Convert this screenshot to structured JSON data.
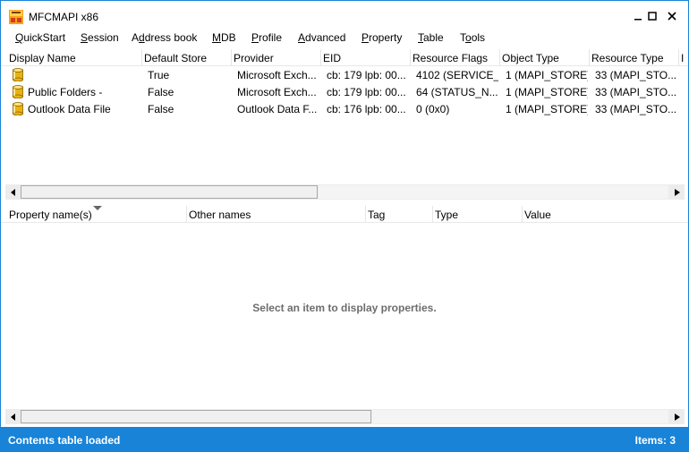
{
  "window": {
    "title": "MFCMAPI x86",
    "accent": "#1883d7"
  },
  "menu": [
    {
      "pre": "",
      "u": "Q",
      "post": "uickStart"
    },
    {
      "pre": "",
      "u": "S",
      "post": "ession"
    },
    {
      "pre": "A",
      "u": "d",
      "post": "dress book"
    },
    {
      "pre": "",
      "u": "M",
      "post": "DB"
    },
    {
      "pre": "",
      "u": "P",
      "post": "rofile"
    },
    {
      "pre": "",
      "u": "A",
      "post": "dvanced"
    },
    {
      "pre": "",
      "u": "P",
      "post": "roperty"
    },
    {
      "pre": "",
      "u": "T",
      "post": "able"
    },
    {
      "pre": "T",
      "u": "o",
      "post": "ols"
    }
  ],
  "stores_table": {
    "columns": [
      "Display Name",
      "Default Store",
      "Provider",
      "EID",
      "Resource Flags",
      "Object Type",
      "Resource Type",
      "I"
    ],
    "rows": [
      [
        "",
        "True",
        "Microsoft Exch...",
        "cb: 179 lpb: 00...",
        "4102 (SERVICE_...",
        "1 (MAPI_STORE)",
        "33 (MAPI_STO..."
      ],
      [
        "Public Folders -",
        "False",
        "Microsoft Exch...",
        "cb: 179 lpb: 00...",
        "64 (STATUS_N...",
        "1 (MAPI_STORE)",
        "33 (MAPI_STO..."
      ],
      [
        "Outlook Data File",
        "False",
        "Outlook Data F...",
        "cb: 176 lpb: 00...",
        "0 (0x0)",
        "1 (MAPI_STORE)",
        "33 (MAPI_STO..."
      ]
    ],
    "row_icon": "database-icon"
  },
  "props_table": {
    "columns": [
      "Property name(s)",
      "Other names",
      "Tag",
      "Type",
      "Value"
    ],
    "sort_indicator": "sort-down-icon",
    "placeholder": "Select an item to display properties."
  },
  "status": {
    "left": "Contents table loaded",
    "right": "Items: 3"
  }
}
